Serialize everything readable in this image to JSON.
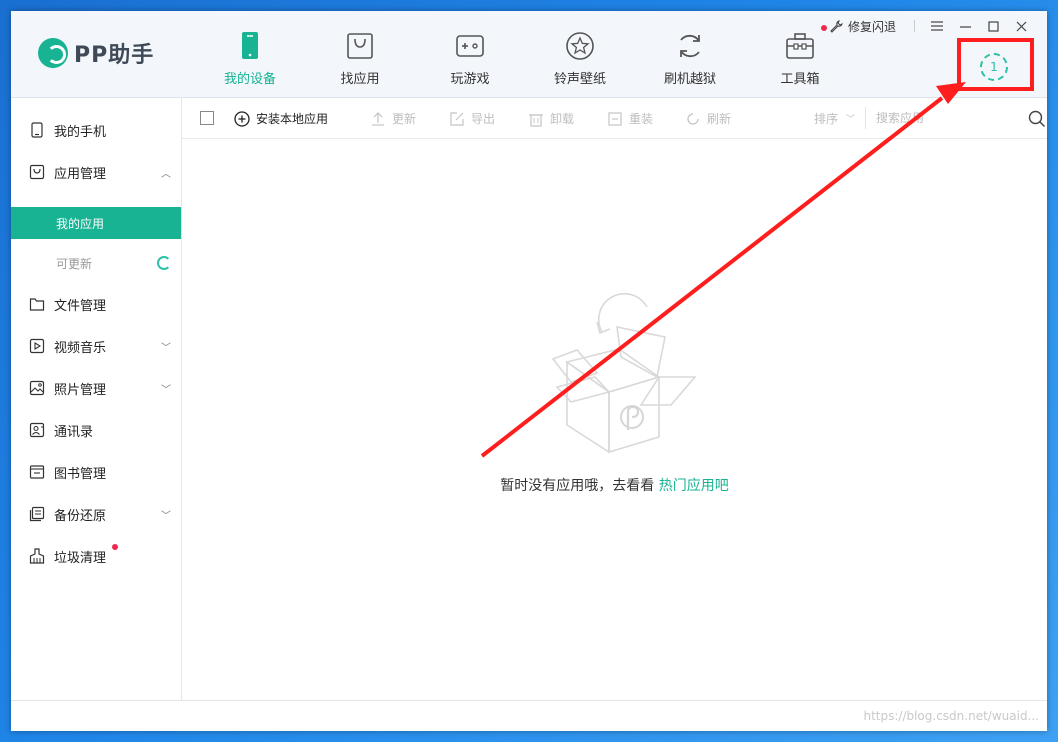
{
  "app": {
    "name": "PP助手"
  },
  "nav": {
    "items": [
      {
        "label": "我的设备",
        "icon": "phone-icon",
        "active": true
      },
      {
        "label": "找应用",
        "icon": "shopping-bag-icon",
        "active": false
      },
      {
        "label": "玩游戏",
        "icon": "gamepad-icon",
        "active": false
      },
      {
        "label": "铃声壁纸",
        "icon": "star-circle-icon",
        "active": false
      },
      {
        "label": "刷机越狱",
        "icon": "refresh-icon",
        "active": false
      },
      {
        "label": "工具箱",
        "icon": "toolbox-icon",
        "active": false,
        "notification": true
      }
    ]
  },
  "topbar": {
    "repair_label": "修复闪退"
  },
  "download": {
    "count": "1"
  },
  "sidebar": {
    "items": [
      {
        "label": "我的手机",
        "icon": "phone-icon"
      },
      {
        "label": "应用管理",
        "icon": "bag-icon",
        "expanded": true
      },
      {
        "label": "我的应用",
        "sub": true,
        "active": true
      },
      {
        "label": "可更新",
        "sub": true,
        "loading": true
      },
      {
        "label": "文件管理",
        "icon": "folder-icon"
      },
      {
        "label": "视频音乐",
        "icon": "play-icon",
        "collapsible": true
      },
      {
        "label": "照片管理",
        "icon": "image-icon",
        "collapsible": true
      },
      {
        "label": "通讯录",
        "icon": "contacts-icon"
      },
      {
        "label": "图书管理",
        "icon": "book-icon"
      },
      {
        "label": "备份还原",
        "icon": "backup-icon",
        "collapsible": true
      },
      {
        "label": "垃圾清理",
        "icon": "broom-icon",
        "notification": true
      }
    ]
  },
  "toolbar": {
    "install_label": "安装本地应用",
    "update_label": "更新",
    "export_label": "导出",
    "uninstall_label": "卸载",
    "reinstall_label": "重装",
    "refresh_label": "刷新",
    "sort_label": "排序",
    "search_placeholder": "搜索应用"
  },
  "empty": {
    "message": "暂时没有应用哦，去看看",
    "link": "热门应用吧"
  },
  "watermark": "https://blog.csdn.net/wuaid...",
  "colors": {
    "accent": "#17b392",
    "annotation": "#ff1e1e",
    "notification": "#f0284a"
  }
}
